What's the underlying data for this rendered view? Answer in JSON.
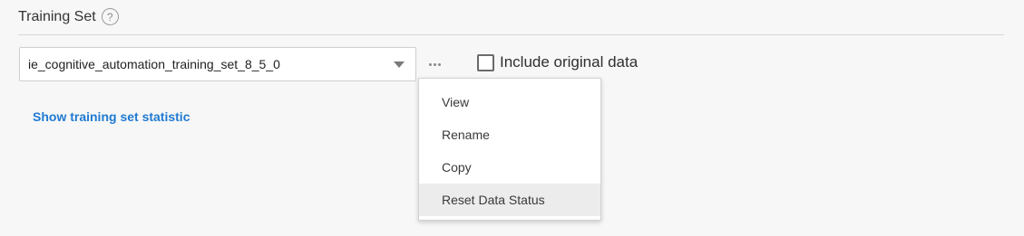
{
  "section": {
    "title": "Training Set",
    "help_glyph": "?"
  },
  "training_set_select": {
    "value": "ie_cognitive_automation_training_set_8_5_0"
  },
  "more_button": {
    "icon": "more-horizontal-icon"
  },
  "include_original": {
    "label": "Include original data",
    "checked": false
  },
  "stats_link": {
    "label": "Show training set statistic"
  },
  "menu": {
    "items": [
      {
        "label": "View"
      },
      {
        "label": "Rename"
      },
      {
        "label": "Copy"
      },
      {
        "label": "Reset Data Status"
      }
    ],
    "highlighted_index": 3
  },
  "colors": {
    "link": "#1f7ad1",
    "background": "#f7f7f7",
    "menu_highlight": "#ececec"
  }
}
